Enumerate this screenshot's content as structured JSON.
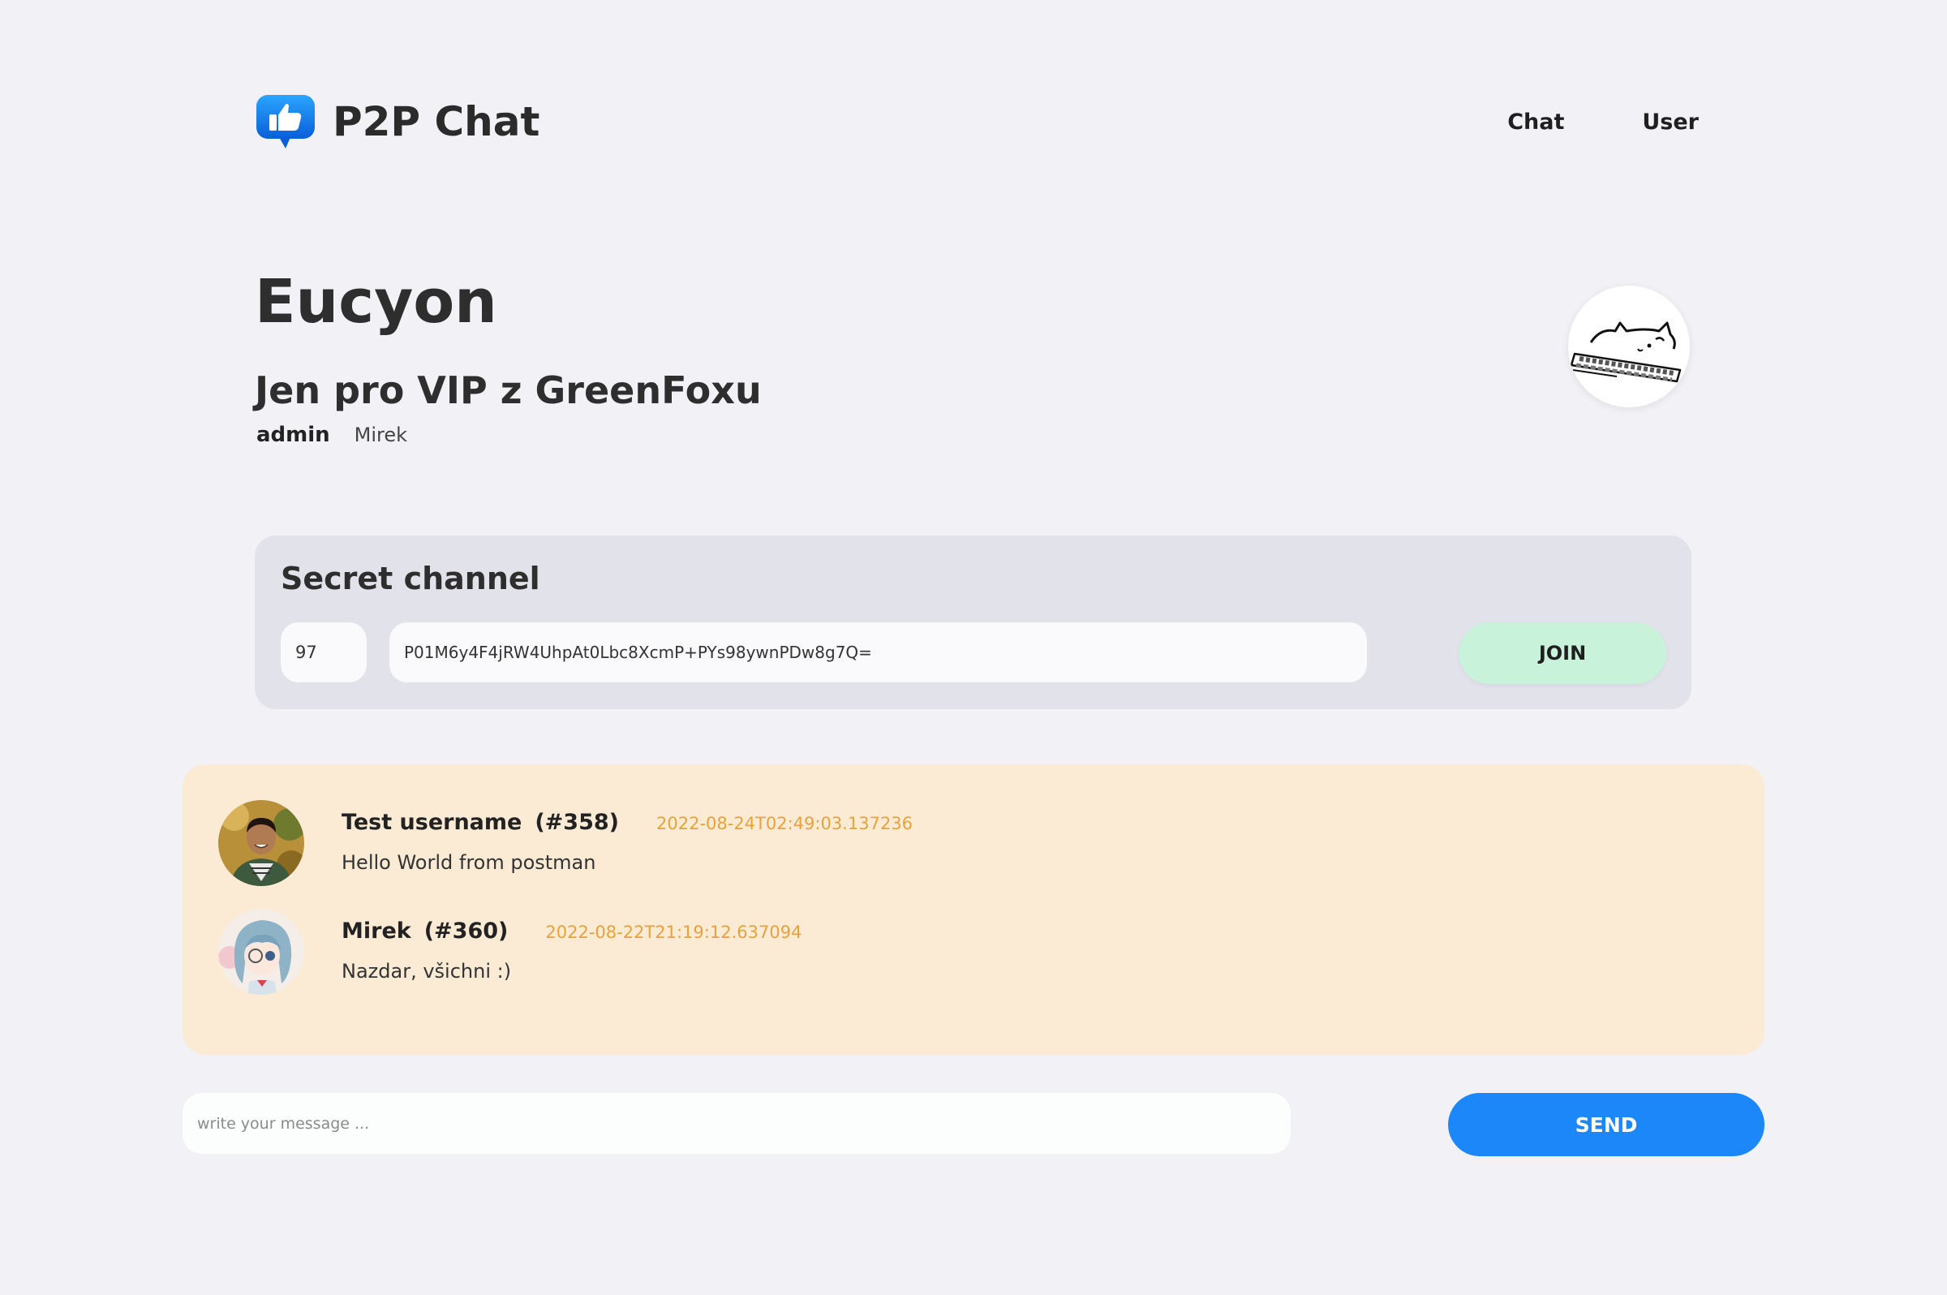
{
  "app": {
    "brand": "P2P Chat",
    "logo_icon": "thumbs-up-chat-bubble-icon",
    "accent_color": "#1c87f8"
  },
  "nav": {
    "items": [
      {
        "label": "Chat"
      },
      {
        "label": "User"
      }
    ]
  },
  "room": {
    "title": "Eucyon",
    "description": "Jen pro VIP z GreenFoxu",
    "role": "admin",
    "owner": "Mirek",
    "avatar_icon": "cat-on-keyboard-icon"
  },
  "secret_channel": {
    "title": "Secret channel",
    "channel_id": "97",
    "channel_key": "P01M6y4F4jRW4UhpAt0Lbc8XcmP+PYs98ywnPDw8g7Q=",
    "join_label": "JOIN",
    "join_color": "#c8f2d9"
  },
  "messages": [
    {
      "username": "Test username",
      "user_id": "(#358)",
      "timestamp": "2022-08-24T02:49:03.137236",
      "text": "Hello World from postman",
      "avatar_icon": "man-photo-avatar-icon"
    },
    {
      "username": "Mirek",
      "user_id": "(#360)",
      "timestamp": "2022-08-22T21:19:12.637094",
      "text": "Nazdar, všichni :)",
      "avatar_icon": "anime-girl-avatar-icon"
    }
  ],
  "composer": {
    "value": "",
    "placeholder": "write your message ...",
    "send_label": "SEND"
  }
}
